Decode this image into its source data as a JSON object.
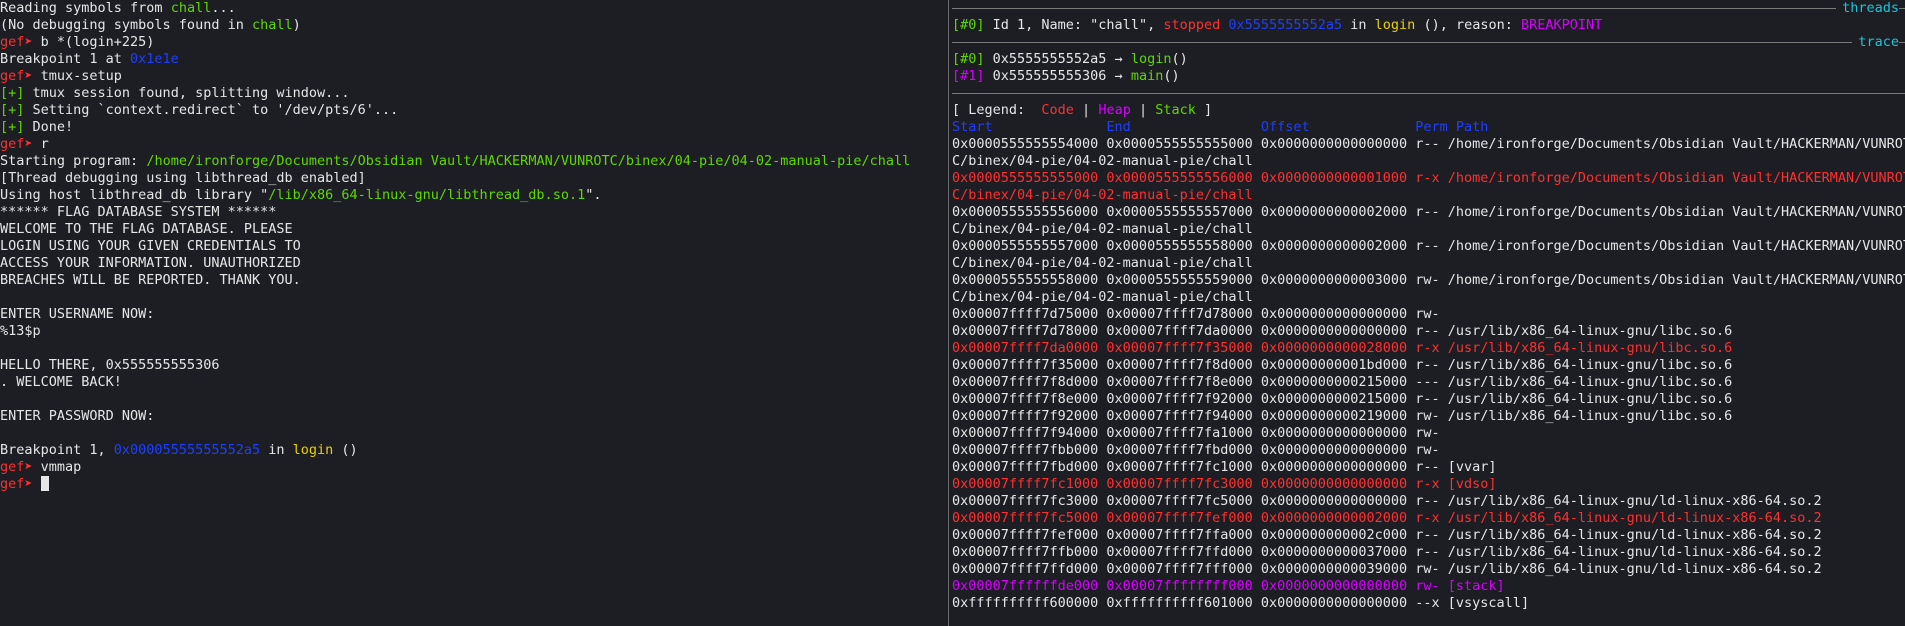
{
  "left": {
    "read_prefix": "Reading symbols from ",
    "read_file": "chall",
    "read_suffix": "...",
    "nosym_prefix": "(No debugging symbols found in ",
    "nosym_file": "chall",
    "nosym_suffix": ")",
    "prompt": "gef➤",
    "cmd_break": " b *(login+225)",
    "bp_prefix": "Breakpoint 1 at ",
    "bp_addr": "0x1e1e",
    "cmd_tmux": " tmux-setup",
    "plus": "[+]",
    "tmux_found": " tmux session found, splitting window...",
    "redirect": " Setting `context.redirect` to '/dev/pts/6'...",
    "done": " Done!",
    "cmd_run": " r",
    "start_prefix": "Starting program: ",
    "start_path": "/home/ironforge/Documents/Obsidian Vault/HACKERMAN/VUNROTC/binex/04-pie/04-02-manual-pie/chall",
    "thread_dbg": "[Thread debugging using libthread_db enabled]",
    "host_prefix": "Using host libthread_db library \"",
    "host_path": "/lib/x86_64-linux-gnu/libthread_db.so.1",
    "host_suffix": "\".",
    "banner": [
      "****** FLAG DATABASE SYSTEM ******",
      "WELCOME TO THE FLAG DATABASE. PLEASE",
      "LOGIN USING YOUR GIVEN CREDENTIALS TO",
      "ACCESS YOUR INFORMATION. UNAUTHORIZED",
      "BREACHES WILL BE REPORTED. THANK YOU."
    ],
    "enter_user": "ENTER USERNAME NOW:",
    "user_input": "%13$p",
    "hello": "HELLO THERE, 0x555555555306",
    "welcome_back": ". WELCOME BACK!",
    "enter_pass": "ENTER PASSWORD NOW:",
    "bphit_prefix": "Breakpoint 1, ",
    "bphit_addr": "0x00005555555552a5",
    "bphit_in": " in ",
    "bphit_fn": "login",
    "bphit_suffix": " ()",
    "cmd_vmmap": " vmmap"
  },
  "right": {
    "threads_label": "threads",
    "th_idx": "[#0]",
    "th_text1": " Id 1, Name: \"chall\", ",
    "th_stopped": "stopped",
    "th_addr": " 0x5555555552a5",
    "th_in": " in ",
    "th_fn": "login",
    "th_reason_pre": " (), reason: ",
    "th_reason": "BREAKPOINT",
    "trace_label": "trace",
    "trace": [
      {
        "idx": "[#0]",
        "addr": " 0x5555555552a5 → ",
        "fn": "login",
        "suffix": "()"
      },
      {
        "idx": "[#1]",
        "addr": " 0x555555555306 → ",
        "fn": "main",
        "suffix": "()"
      }
    ],
    "legend_open": "[ Legend:  ",
    "legend_code": "Code",
    "legend_bar": " | ",
    "legend_heap": "Heap",
    "legend_stack": "Stack",
    "legend_close": " ]",
    "col_headers": "Start              End                Offset             Perm Path",
    "maps": [
      {
        "type": "normal",
        "text": "0x0000555555554000 0x0000555555555000 0x0000000000000000 r-- /home/ironforge/Documents/Obsidian Vault/HACKERMAN/VUNROT"
      },
      {
        "type": "normal",
        "text": "C/binex/04-pie/04-02-manual-pie/chall"
      },
      {
        "type": "code",
        "text": "0x0000555555555000 0x0000555555556000 0x0000000000001000 r-x /home/ironforge/Documents/Obsidian Vault/HACKERMAN/VUNROT"
      },
      {
        "type": "code",
        "text": "C/binex/04-pie/04-02-manual-pie/chall"
      },
      {
        "type": "normal",
        "text": "0x0000555555556000 0x0000555555557000 0x0000000000002000 r-- /home/ironforge/Documents/Obsidian Vault/HACKERMAN/VUNROT"
      },
      {
        "type": "normal",
        "text": "C/binex/04-pie/04-02-manual-pie/chall"
      },
      {
        "type": "normal",
        "text": "0x0000555555557000 0x0000555555558000 0x0000000000002000 r-- /home/ironforge/Documents/Obsidian Vault/HACKERMAN/VUNROT"
      },
      {
        "type": "normal",
        "text": "C/binex/04-pie/04-02-manual-pie/chall"
      },
      {
        "type": "normal",
        "text": "0x0000555555558000 0x0000555555559000 0x0000000000003000 rw- /home/ironforge/Documents/Obsidian Vault/HACKERMAN/VUNROT"
      },
      {
        "type": "normal",
        "text": "C/binex/04-pie/04-02-manual-pie/chall"
      },
      {
        "type": "normal",
        "text": "0x00007ffff7d75000 0x00007ffff7d78000 0x0000000000000000 rw-"
      },
      {
        "type": "normal",
        "text": "0x00007ffff7d78000 0x00007ffff7da0000 0x0000000000000000 r-- /usr/lib/x86_64-linux-gnu/libc.so.6"
      },
      {
        "type": "code",
        "text": "0x00007ffff7da0000 0x00007ffff7f35000 0x0000000000028000 r-x /usr/lib/x86_64-linux-gnu/libc.so.6"
      },
      {
        "type": "normal",
        "text": "0x00007ffff7f35000 0x00007ffff7f8d000 0x00000000001bd000 r-- /usr/lib/x86_64-linux-gnu/libc.so.6"
      },
      {
        "type": "normal",
        "text": "0x00007ffff7f8d000 0x00007ffff7f8e000 0x0000000000215000 --- /usr/lib/x86_64-linux-gnu/libc.so.6"
      },
      {
        "type": "normal",
        "text": "0x00007ffff7f8e000 0x00007ffff7f92000 0x0000000000215000 r-- /usr/lib/x86_64-linux-gnu/libc.so.6"
      },
      {
        "type": "normal",
        "text": "0x00007ffff7f92000 0x00007ffff7f94000 0x0000000000219000 rw- /usr/lib/x86_64-linux-gnu/libc.so.6"
      },
      {
        "type": "normal",
        "text": "0x00007ffff7f94000 0x00007ffff7fa1000 0x0000000000000000 rw-"
      },
      {
        "type": "normal",
        "text": "0x00007ffff7fbb000 0x00007ffff7fbd000 0x0000000000000000 rw-"
      },
      {
        "type": "normal",
        "text": "0x00007ffff7fbd000 0x00007ffff7fc1000 0x0000000000000000 r-- [vvar]"
      },
      {
        "type": "code",
        "text": "0x00007ffff7fc1000 0x00007ffff7fc3000 0x0000000000000000 r-x [vdso]"
      },
      {
        "type": "normal",
        "text": "0x00007ffff7fc3000 0x00007ffff7fc5000 0x0000000000000000 r-- /usr/lib/x86_64-linux-gnu/ld-linux-x86-64.so.2"
      },
      {
        "type": "code",
        "text": "0x00007ffff7fc5000 0x00007ffff7fef000 0x0000000000002000 r-x /usr/lib/x86_64-linux-gnu/ld-linux-x86-64.so.2"
      },
      {
        "type": "normal",
        "text": "0x00007ffff7fef000 0x00007ffff7ffa000 0x000000000002c000 r-- /usr/lib/x86_64-linux-gnu/ld-linux-x86-64.so.2"
      },
      {
        "type": "normal",
        "text": "0x00007ffff7ffb000 0x00007ffff7ffd000 0x0000000000037000 r-- /usr/lib/x86_64-linux-gnu/ld-linux-x86-64.so.2"
      },
      {
        "type": "normal",
        "text": "0x00007ffff7ffd000 0x00007ffff7fff000 0x0000000000039000 rw- /usr/lib/x86_64-linux-gnu/ld-linux-x86-64.so.2"
      },
      {
        "type": "stack",
        "text": "0x00007ffffffde000 0x00007ffffffff000 0x0000000000000000 rw- [stack]"
      },
      {
        "type": "normal",
        "text": "0xffffffffff600000 0xffffffffff601000 0x0000000000000000 --x [vsyscall]"
      }
    ]
  }
}
